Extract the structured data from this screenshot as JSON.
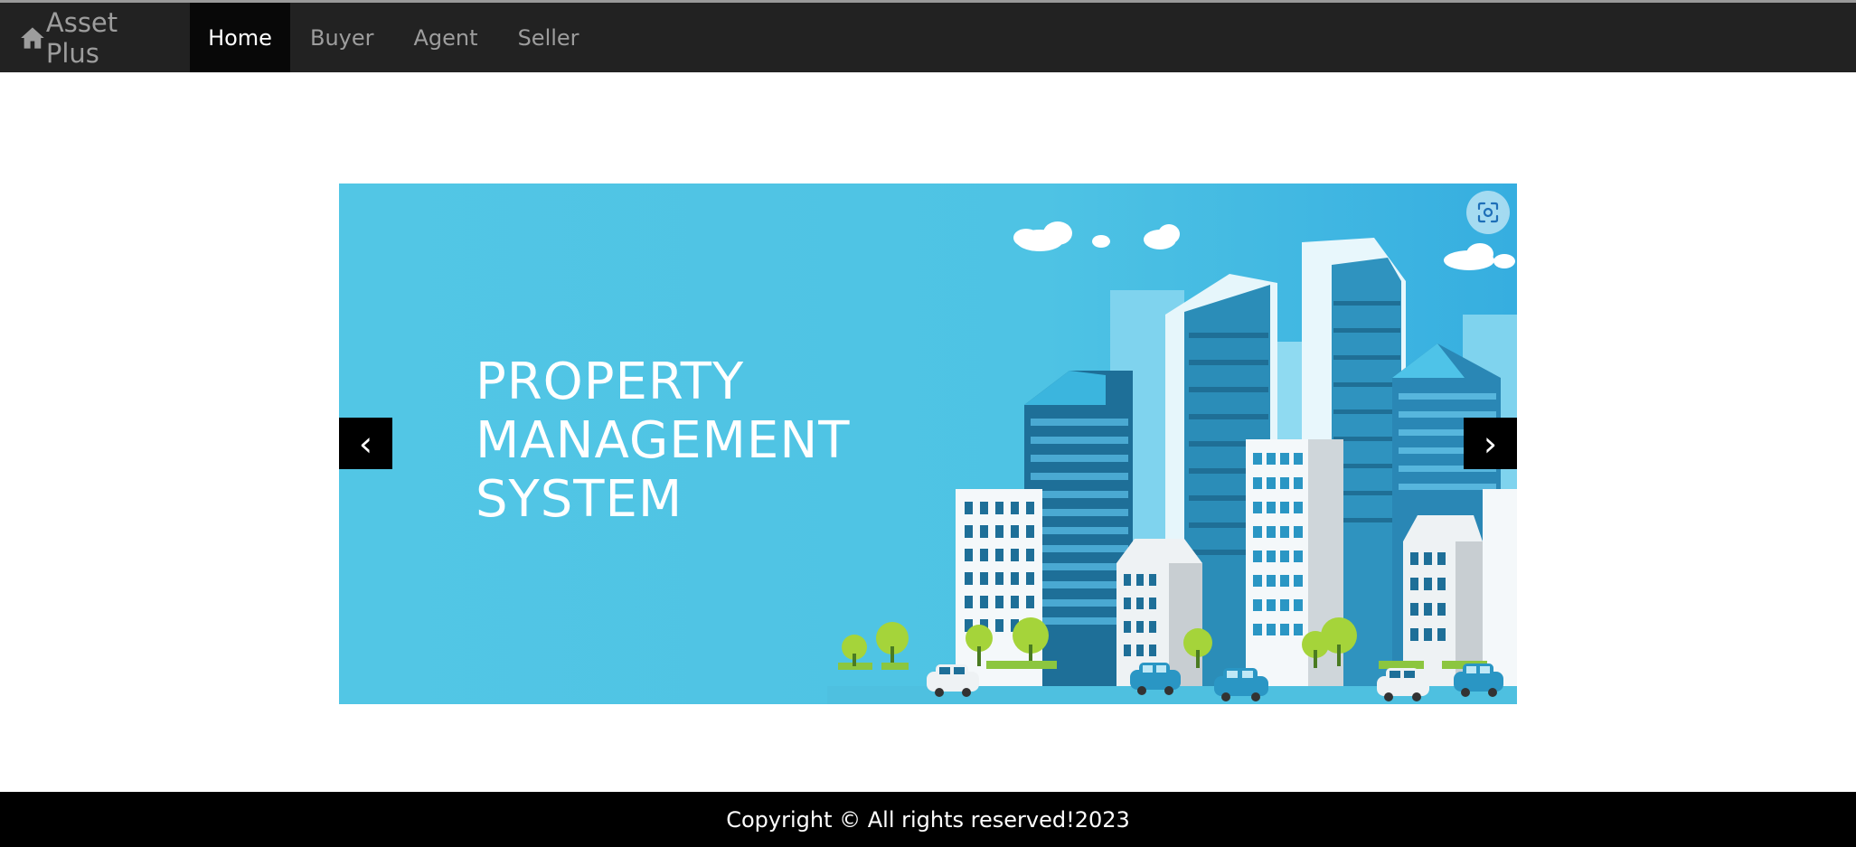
{
  "app": {
    "brand": "Asset Plus",
    "brand_icon": "home-icon"
  },
  "nav": {
    "items": [
      {
        "label": "Home",
        "active": true
      },
      {
        "label": "Buyer",
        "active": false
      },
      {
        "label": "Agent",
        "active": false
      },
      {
        "label": "Seller",
        "active": false
      }
    ]
  },
  "carousel": {
    "slide_text": [
      "PROPERTY",
      "MANAGEMENT",
      "SYSTEM"
    ],
    "prev_label": "‹",
    "next_label": "›",
    "lens_icon": "visual-search-icon",
    "background_color": "#50c5e6"
  },
  "footer": {
    "text": "Copyright © All rights reserved!2023"
  },
  "colors": {
    "navbar": "#222222",
    "nav_active": "#080808",
    "nav_text": "#9d9d9d",
    "footer": "#000000"
  }
}
